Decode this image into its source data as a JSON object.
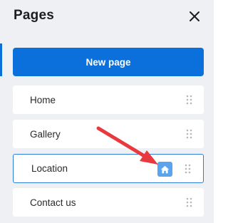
{
  "header": {
    "title": "Pages",
    "close_icon": "close-icon"
  },
  "new_page_button": {
    "label": "New page"
  },
  "pages": [
    {
      "label": "Home",
      "selected": false
    },
    {
      "label": "Gallery",
      "selected": false
    },
    {
      "label": "Location",
      "selected": true,
      "home_icon": "home-icon"
    },
    {
      "label": "Contact us",
      "selected": false
    }
  ],
  "colors": {
    "accent": "#0b70dc",
    "selected_border": "#2d7fdc",
    "home_button": "#5aa3ee",
    "annotation_arrow": "#e8393e",
    "panel_background": "#eef0f3"
  }
}
